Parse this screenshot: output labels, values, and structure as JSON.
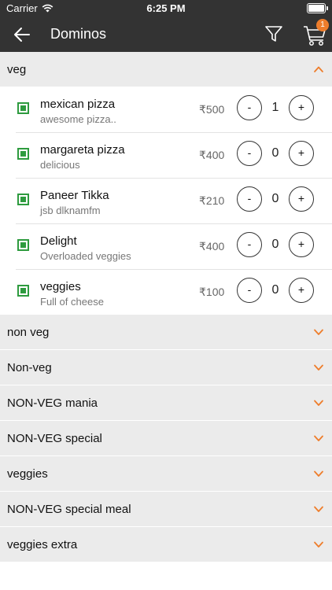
{
  "status": {
    "carrier": "Carrier",
    "time": "6:25 PM"
  },
  "header": {
    "title": "Dominos",
    "cart_count": "1"
  },
  "colors": {
    "accent": "#ee7d2b",
    "veg": "#2e9b3f",
    "header_bg": "#333333"
  },
  "open_section": {
    "title": "veg",
    "items": [
      {
        "name": "mexican pizza",
        "desc": "awesome pizza..",
        "price": "₹500",
        "qty": "1"
      },
      {
        "name": "margareta pizza",
        "desc": "delicious",
        "price": "₹400",
        "qty": "0"
      },
      {
        "name": "Paneer Tikka",
        "desc": "jsb dlknamfm",
        "price": "₹210",
        "qty": "0"
      },
      {
        "name": "Delight",
        "desc": "Overloaded veggies",
        "price": "₹400",
        "qty": "0"
      },
      {
        "name": "veggies",
        "desc": "Full of cheese",
        "price": "₹100",
        "qty": "0"
      }
    ]
  },
  "stepper": {
    "minus": "-",
    "plus": "+"
  },
  "sections": [
    "non veg",
    "Non-veg",
    "NON-VEG mania",
    "NON-VEG special",
    "veggies",
    "NON-VEG special meal",
    "veggies extra"
  ]
}
